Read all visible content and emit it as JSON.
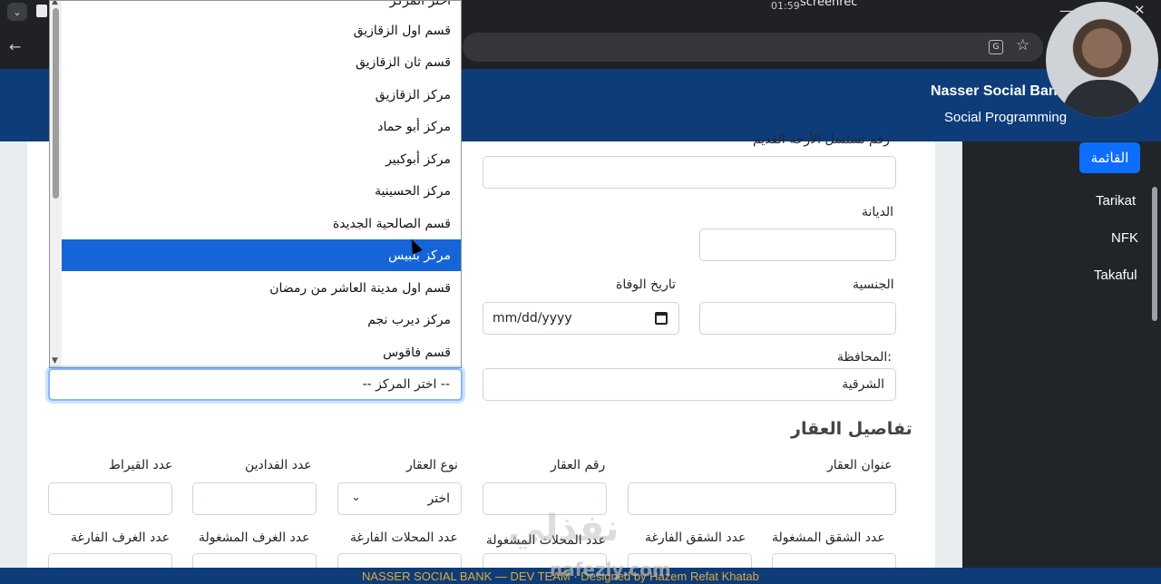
{
  "browser": {
    "recorder_label": "01:59",
    "recorder_brand": "screenrec",
    "translate_icon_glyph": "G"
  },
  "header": {
    "title": "Nasser Social Ban",
    "subtitle": "Social Programming"
  },
  "sidebar": {
    "active": "القائمة",
    "items": [
      "Tarikat",
      "NFK",
      "Takaful"
    ]
  },
  "dropdown": {
    "partial_top": "اختر المركز",
    "items": [
      "قسم اول الزقازيق",
      "قسم ثان الزقازيق",
      "مركز الزقازيق",
      "مركز أبو حماد",
      "مركز أبوكبير",
      "مركز الحسينية",
      "قسم الصالحية الجديدة",
      "مركز بلبيس",
      "قسم اول مدينة العاشر من رمضان",
      "مركز ديرب نجم",
      "قسم فاقوس"
    ],
    "selected_index": 7,
    "select_value": "-- اختر المركز --"
  },
  "form": {
    "partial_label": "رقم تسلسل الأرحة القديم",
    "religion_label": "الديانة",
    "nationality_label": "الجنسية",
    "death_date_label": "تاريخ الوفاة",
    "death_date_placeholder": "mm/dd/yyyy",
    "governorate_label": "المحافظة:",
    "governorate_value": "الشرقية"
  },
  "property": {
    "title": "تفاصيل العقار",
    "address_label": "عنوان العقار",
    "number_label": "رقم العقار",
    "type_label": "نوع العقار",
    "type_value": "اختر",
    "feddans_label": "عدد الفدادين",
    "qirats_label": "عدد القيراط",
    "occupied_apts_label": "عدد الشقق المشغولة",
    "vacant_apts_label": "عدد الشقق الفارغة",
    "occupied_shops_label": "عدد المحلات المشغولة",
    "vacant_shops_label": "عدد المحلات الفارغة",
    "occupied_rooms_label": "عدد الغرف المشغولة",
    "vacant_rooms_label": "عدد الغرف الفارغة"
  },
  "footer": {
    "text": "NASSER SOCIAL BANK — DEV TEAM · Designed by Hazem Refat Khatab"
  },
  "watermark": {
    "logo": "نفذلي",
    "url": "nafezly.com"
  }
}
